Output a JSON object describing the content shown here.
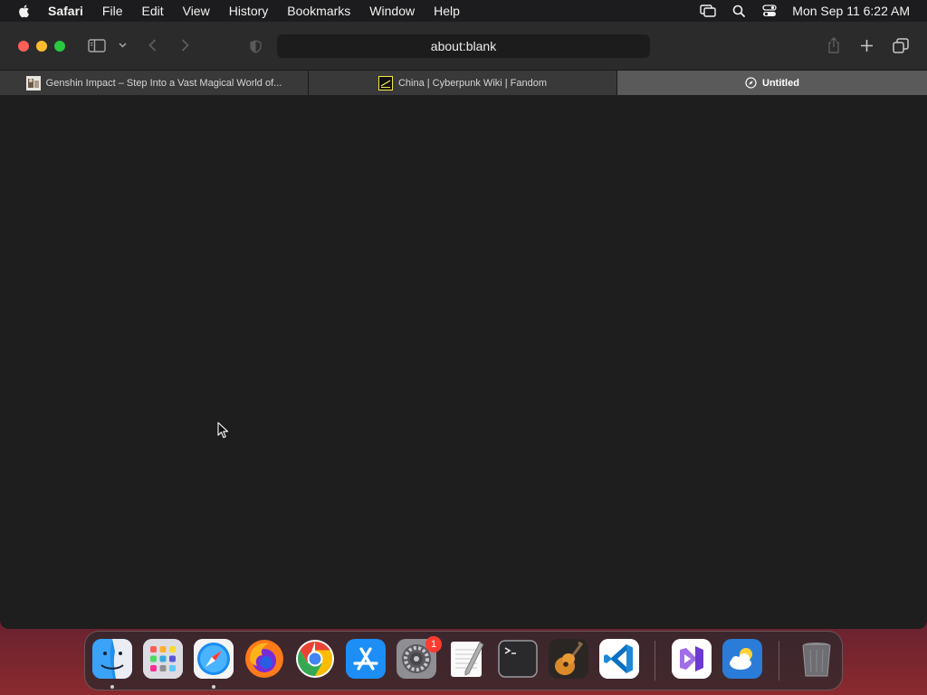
{
  "menubar": {
    "app_name": "Safari",
    "menus": [
      "File",
      "Edit",
      "View",
      "History",
      "Bookmarks",
      "Window",
      "Help"
    ],
    "clock": "Mon Sep 11  6:22 AM",
    "status_icons": [
      "screen-mirroring-icon",
      "spotlight-search-icon",
      "control-center-icon"
    ]
  },
  "safari": {
    "address": "about:blank",
    "tabs": [
      {
        "title": "Genshin Impact – Step Into a Vast Magical World of...",
        "favicon": "genshin-favicon",
        "active": false
      },
      {
        "title": "China | Cyberpunk Wiki | Fandom",
        "favicon": "cyberpunk-wiki-favicon",
        "active": false
      },
      {
        "title": "Untitled",
        "favicon": "compass-icon",
        "active": true
      }
    ]
  },
  "dock": {
    "apps": [
      {
        "name": "Finder",
        "icon": "finder-icon",
        "running": true
      },
      {
        "name": "Launchpad",
        "icon": "launchpad-icon",
        "running": false
      },
      {
        "name": "Safari",
        "icon": "safari-icon",
        "running": true
      },
      {
        "name": "Firefox",
        "icon": "firefox-icon",
        "running": false
      },
      {
        "name": "Chrome",
        "icon": "chrome-icon",
        "running": false
      },
      {
        "name": "App Store",
        "icon": "app-store-icon",
        "running": false
      },
      {
        "name": "System Settings",
        "icon": "system-settings-icon",
        "running": false,
        "badge": "1"
      },
      {
        "name": "TextEdit",
        "icon": "textedit-icon",
        "running": false
      },
      {
        "name": "Terminal",
        "icon": "terminal-icon",
        "running": false
      },
      {
        "name": "GarageBand",
        "icon": "garageband-icon",
        "running": false
      },
      {
        "name": "Visual Studio Code",
        "icon": "vscode-icon",
        "running": false
      },
      {
        "name": "Visual Studio",
        "icon": "visual-studio-icon",
        "running": false
      },
      {
        "name": "Weather",
        "icon": "weather-icon",
        "running": false
      },
      {
        "name": "Trash",
        "icon": "trash-icon",
        "running": false
      }
    ]
  }
}
